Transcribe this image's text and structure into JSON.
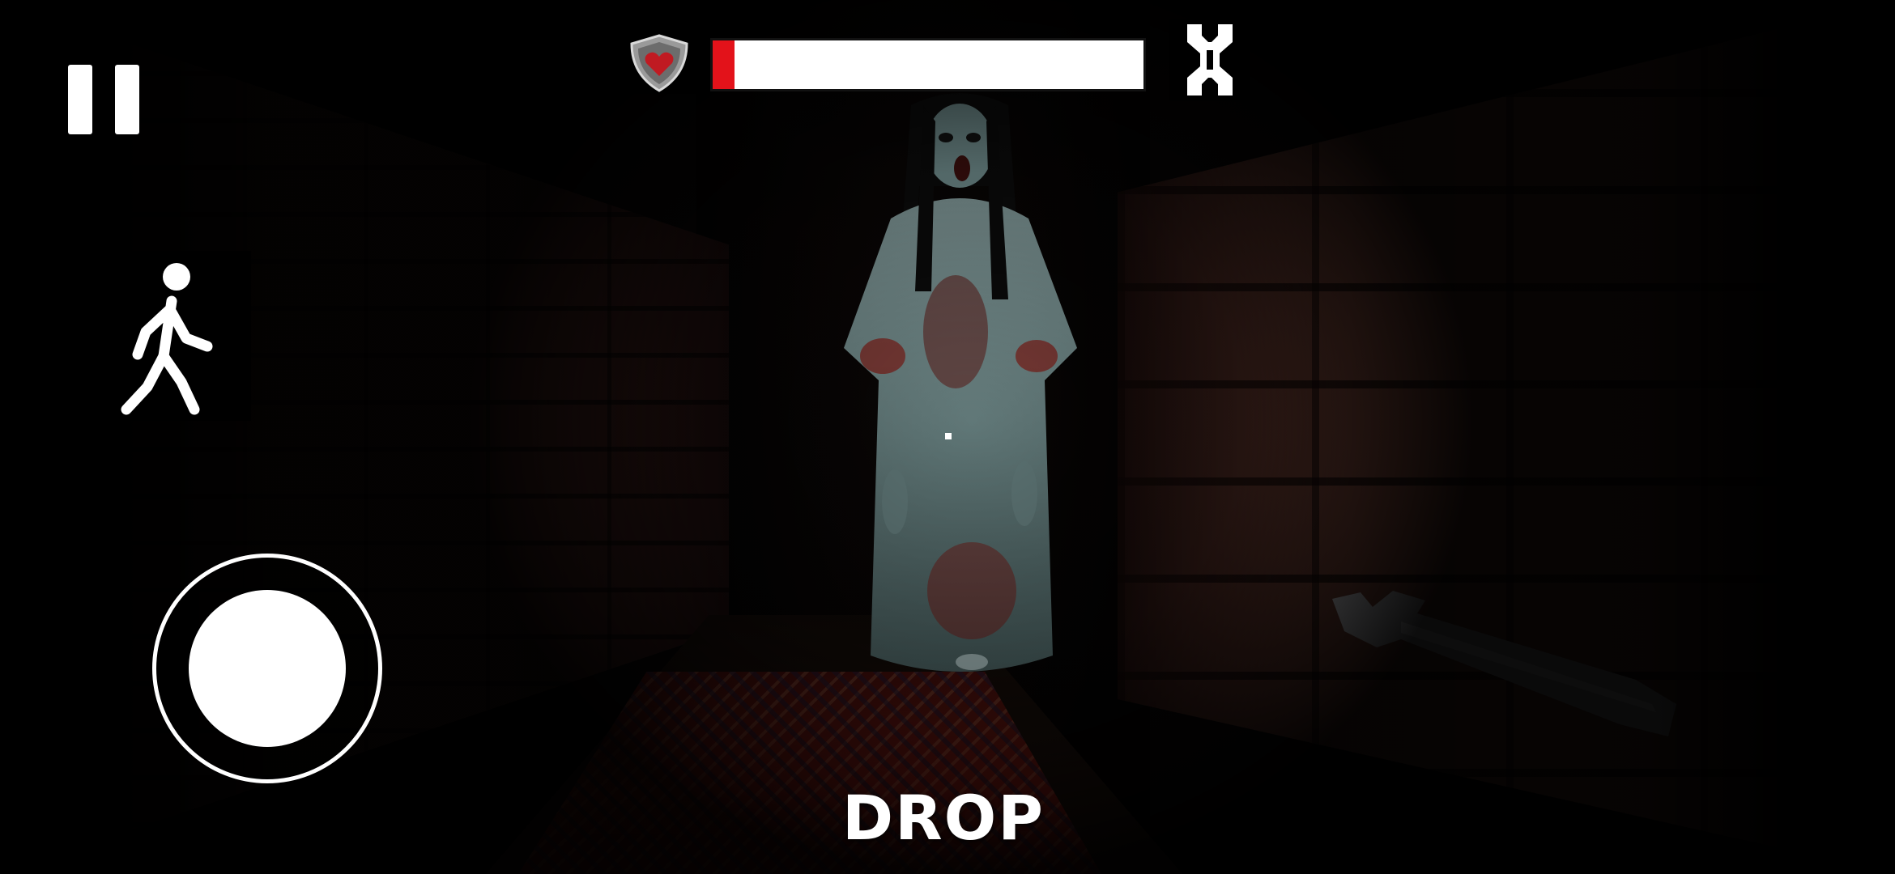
{
  "hud": {
    "pause": {
      "icon": "pause-icon"
    },
    "movement_mode": {
      "icon": "walk-icon"
    },
    "health": {
      "icon": "shield-heart-icon",
      "level": 0.05,
      "fill_color": "#e3121a",
      "empty_color": "#ffffff"
    },
    "equipped_tool": {
      "icon": "wrench-icon"
    },
    "drop_label": "DROP",
    "joystick": {
      "icon": "joystick-icon"
    }
  },
  "scene": {
    "enemy": "ghost-girl",
    "held_item": "wrench"
  }
}
